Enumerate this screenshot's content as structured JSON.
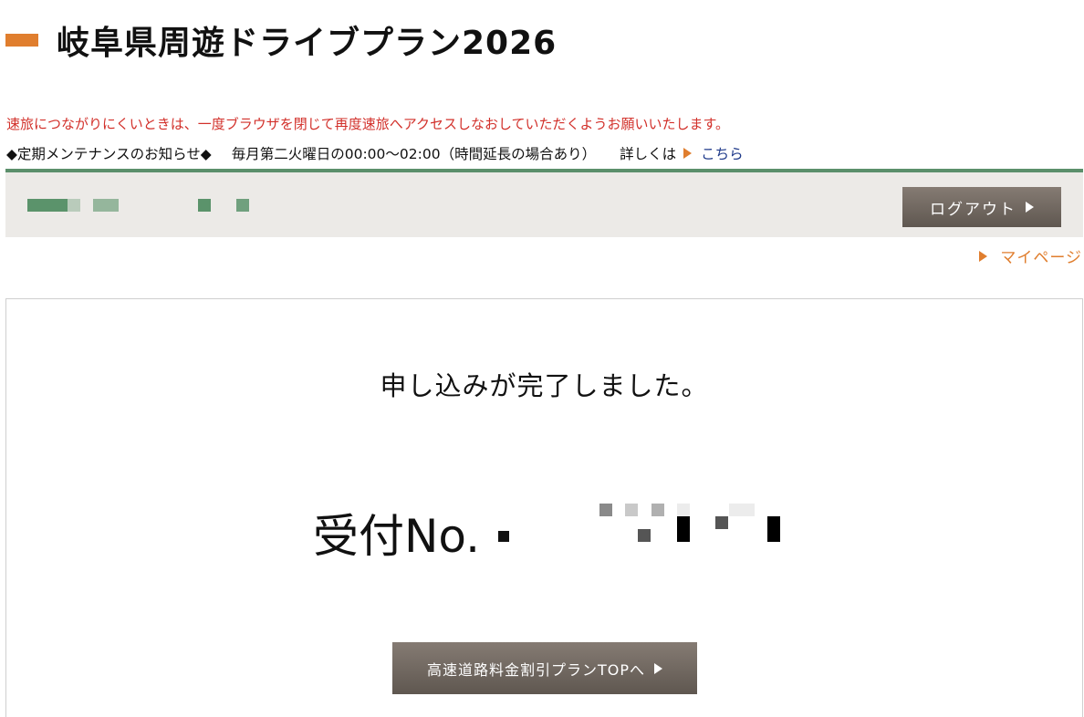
{
  "header": {
    "title": "岐阜県周遊ドライブプラン2026",
    "accent_color": "#e07e2e"
  },
  "notice": {
    "warning": "速旅につながりにくいときは、一度ブラウザを閉じて再度速旅へアクセスしなおしていただくようお願いいたします。",
    "maintenance_label": "◆定期メンテナンスのお知らせ◆",
    "maintenance_schedule": "毎月第二火曜日の00:00〜02:00（時間延長の場合あり）",
    "details_prefix": "詳しくは",
    "details_link": "こちら",
    "warning_color": "#d2302a"
  },
  "user_bar": {
    "logout_label": "ログアウト",
    "accent_color": "#5b8f6b"
  },
  "nav": {
    "mypage_label": "マイページ"
  },
  "completion": {
    "message": "申し込みが完了しました。",
    "receipt_label": "受付No.",
    "top_button_label": "高速道路料金割引プランTOPへ"
  }
}
